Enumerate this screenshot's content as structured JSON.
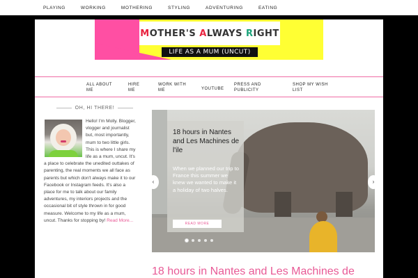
{
  "top_menu": [
    "PLAYING",
    "WORKING",
    "MOTHERING",
    "STYLING",
    "ADVENTURING",
    "EATING"
  ],
  "logo": {
    "title_parts": [
      "M",
      "OTHER'S ",
      "A",
      "LWAYS ",
      "R",
      "IGHT"
    ],
    "subtitle": "LIFE AS A MUM (UNCUT)",
    "colors": {
      "pink": "#ff4fa3",
      "yellow": "#ffff33",
      "red": "#e8233f",
      "green": "#1aa37a"
    }
  },
  "main_nav": [
    {
      "label": "ALL ABOUT ME"
    },
    {
      "label": "HIRE ME"
    },
    {
      "label": "WORK WITH ME"
    },
    {
      "label": "YOUTUBE"
    },
    {
      "label": "PRESS AND PUBLICITY"
    },
    {
      "label": "SHOP MY WISH LIST"
    }
  ],
  "sidebar": {
    "title": "OH, HI THERE!",
    "bio": "Hello! I'm Molly. Blogger, vlogger and journalist but, most importantly, mum to two little girls. This is where I share my life as a mum, uncut. It's a place to celebrate the unedited outtakes of parenting, the real moments we all face as parents but which don't always make it to our Facebook or Instagram feeds. It's also a place for me to talk about our family adventures, my interiors projects and the occasional bit of style thrown in for good measure. Welcome to my life as a mum, uncut. Thanks for stopping by!",
    "read_more": "Read More..."
  },
  "slider": {
    "title": "18 hours in Nantes and Les Machines de l'ile",
    "excerpt": "When we planned our trip to France this summer we knew we wanted to make it a holiday of two halves.",
    "button": "READ MORE",
    "dots": 5,
    "active_dot": 0,
    "prev": "‹",
    "next": "›"
  },
  "post_title": "18 hours in Nantes and Les Machines de"
}
